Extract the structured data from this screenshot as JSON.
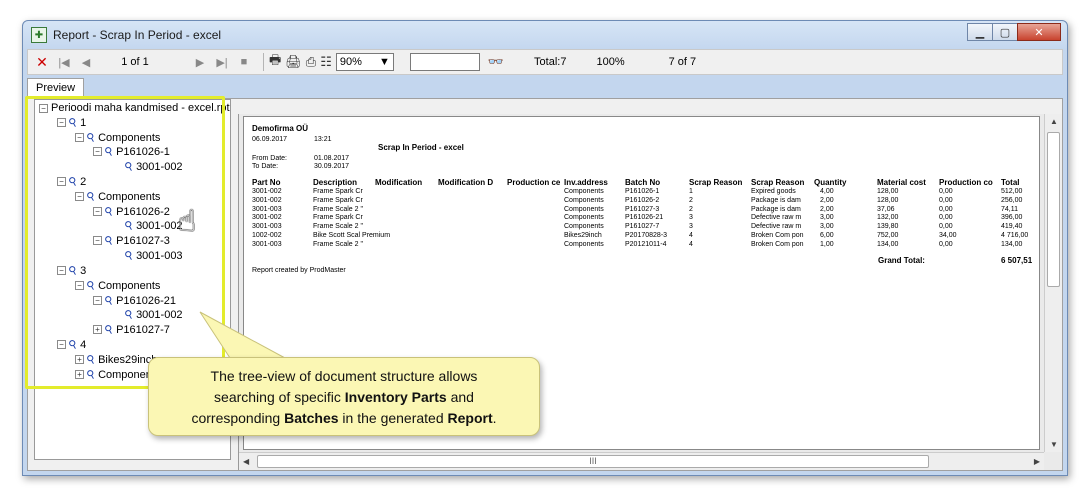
{
  "window": {
    "title": "Report - Scrap In Period - excel"
  },
  "toolbar": {
    "page": "1 of 1",
    "zoom": "90%",
    "total": "Total:7",
    "percent": "100%",
    "of": "7 of 7"
  },
  "tab": "Preview",
  "tree": {
    "root": "Perioodi maha kandmised - excel.rpt",
    "n1": "1",
    "n1_components": "Components",
    "n1_batch": "P161026-1",
    "n1_part": "3001-002",
    "n2": "2",
    "n2_components": "Components",
    "n2_batch1": "P161026-2",
    "n2_part1": "3001-002",
    "n2_batch2": "P161027-3",
    "n2_part2": "3001-003",
    "n3": "3",
    "n3_components": "Components",
    "n3_batch1": "P161026-21",
    "n3_part1": "3001-002",
    "n3_batch2": "P161027-7",
    "n4": "4",
    "n4_bikes": "Bikes29inch",
    "n4_components": "Componen"
  },
  "report": {
    "company": "Demofirma OÜ",
    "date": "06.09.2017",
    "time": "13:21",
    "title": "Scrap In Period - excel",
    "from_label": "From Date:",
    "from_value": "01.08.2017",
    "to_label": "To Date:",
    "to_value": "30.09.2017",
    "headers": [
      "Part No",
      "Description",
      "Modification",
      "Modification D",
      "Production ce",
      "Inv.address",
      "Batch No",
      "Scrap Reason",
      "Scrap Reason",
      "Quantity",
      "Material cost",
      "Production co",
      "Total"
    ],
    "rows": [
      [
        "3001-002",
        "Frame Spark Cr",
        "Components",
        "P161026-1",
        "1",
        "Expired goods",
        "4,00",
        "128,00",
        "0,00",
        "512,00"
      ],
      [
        "3001-002",
        "Frame Spark Cr",
        "Components",
        "P161026-2",
        "2",
        "Package is dam",
        "2,00",
        "128,00",
        "0,00",
        "256,00"
      ],
      [
        "3001-003",
        "Frame Scale 2 \"",
        "Components",
        "P161027-3",
        "2",
        "Package is dam",
        "2,00",
        "37,06",
        "0,00",
        "74,11"
      ],
      [
        "3001-002",
        "Frame Spark Cr",
        "Components",
        "P161026-21",
        "3",
        "Defective raw m",
        "3,00",
        "132,00",
        "0,00",
        "396,00"
      ],
      [
        "3001-003",
        "Frame Scale 2 \"",
        "Components",
        "P161027-7",
        "3",
        "Defective raw m",
        "3,00",
        "139,80",
        "0,00",
        "419,40"
      ],
      [
        "1002-002",
        "Bike Scott Scal Premium",
        "Bikes29inch",
        "P20170828-3",
        "4",
        "Broken Com pon",
        "6,00",
        "752,00",
        "34,00",
        "4 716,00"
      ],
      [
        "3001-003",
        "Frame Scale 2 \"",
        "Components",
        "P20121011-4",
        "4",
        "Broken Com pon",
        "1,00",
        "134,00",
        "0,00",
        "134,00"
      ]
    ],
    "grand_total_label": "Grand Total:",
    "grand_total_value": "6 507,51",
    "footer": "Report created by ProdMaster"
  },
  "callout": {
    "line1": "The tree-view of document structure allows",
    "line2_a": "searching of specific ",
    "line2_b": "Inventory Parts",
    "line2_c": " and",
    "line3_a": "corresponding ",
    "line3_b": "Batches",
    "line3_c": " in the generated ",
    "line3_d": "Report",
    "line3_e": "."
  },
  "colors": {
    "highlight": "#e3ec2c",
    "callout_bg": "#fbf7b4",
    "close_button": "#c8432e"
  }
}
